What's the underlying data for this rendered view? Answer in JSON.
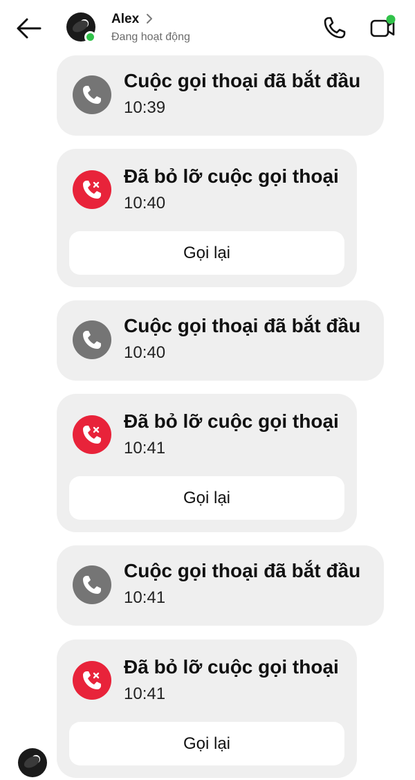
{
  "header": {
    "contact_name": "Alex",
    "status": "Đang hoạt động",
    "online_color": "#31c24a",
    "icons": [
      "back-arrow-icon",
      "avatar",
      "chevron-right-icon",
      "phone-icon",
      "video-camera-icon"
    ]
  },
  "messages": [
    {
      "type": "call-started",
      "title": "Cuộc gọi thoại đã bắt đầu",
      "time": "10:39"
    },
    {
      "type": "call-missed",
      "title": "Đã bỏ lỡ cuộc gọi thoại",
      "time": "10:40",
      "action": "Gọi lại"
    },
    {
      "type": "call-started",
      "title": "Cuộc gọi thoại đã bắt đầu",
      "time": "10:40"
    },
    {
      "type": "call-missed",
      "title": "Đã bỏ lỡ cuộc gọi thoại",
      "time": "10:41",
      "action": "Gọi lại"
    },
    {
      "type": "call-started",
      "title": "Cuộc gọi thoại đã bắt đầu",
      "time": "10:41"
    },
    {
      "type": "call-missed",
      "title": "Đã bỏ lỡ cuộc gọi thoại",
      "time": "10:41",
      "action": "Gọi lại"
    }
  ],
  "colors": {
    "started_icon_bg": "#757575",
    "missed_icon_bg": "#e8233a",
    "card_bg": "#efefef"
  }
}
